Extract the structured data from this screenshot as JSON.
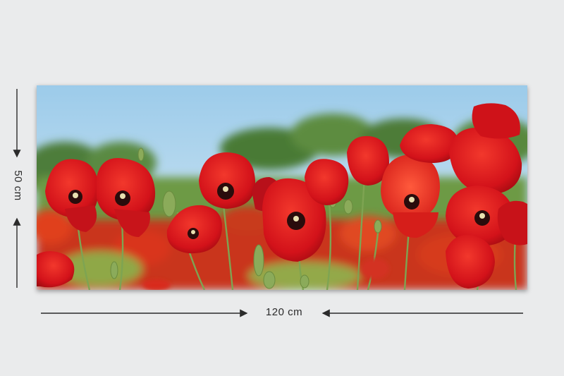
{
  "dimensions": {
    "width_label": "120 cm",
    "height_label": "50 cm"
  },
  "product": {
    "image_subject": "red-poppy-field"
  },
  "colors": {
    "background": "#eaebec",
    "sky": "#a9d3ec",
    "poppy_red": "#d8141b",
    "foliage": "#5f8a3a"
  }
}
